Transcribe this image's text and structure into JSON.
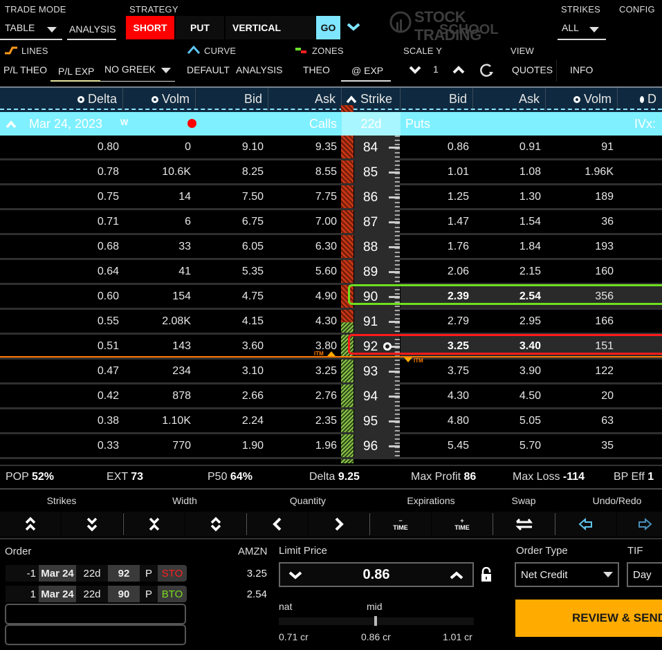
{
  "toolbar": {
    "trade_mode_label": "TRADE MODE",
    "trade_mode_value": "TABLE",
    "analysis_tab": "ANALYSIS",
    "strategy_label": "STRATEGY",
    "strategy_side": "SHORT",
    "strategy_type": "PUT",
    "strategy_kind": "VERTICAL",
    "go_button": "GO",
    "logo_line1": "STOCK TRADING",
    "logo_line2": "SCHOOL",
    "strikes_label": "STRIKES",
    "strikes_value": "ALL",
    "config_label": "CONFIG",
    "lines_label": "LINES",
    "curve_label": "CURVE",
    "zones_label": "ZONES",
    "scale_y_label": "SCALE Y",
    "view_label": "VIEW",
    "pl_theo": "P/L THEO",
    "pl_exp": "P/L EXP",
    "greek_value": "NO GREEK",
    "curve_default": "DEFAULT",
    "curve_analysis": "ANALYSIS",
    "zones_theo": "THEO",
    "zones_exp": "@ EXP",
    "scale_value": "1",
    "view_quotes": "QUOTES",
    "view_info": "INFO"
  },
  "grid": {
    "headers": {
      "call_delta": "Delta",
      "call_volm": "Volm",
      "call_bid": "Bid",
      "call_ask": "Ask",
      "strike": "Strike",
      "put_bid": "Bid",
      "put_ask": "Ask",
      "put_volm": "Volm",
      "put_delta": "D"
    },
    "expiration": {
      "date": "Mar 24, 2023",
      "weekly_tag": "W",
      "calls_label": "Calls",
      "dte": "22d",
      "puts_label": "Puts",
      "ivx_label": "IVx:"
    },
    "itm_label": "ITM",
    "rows": [
      {
        "delta": "0.80",
        "volm": "0",
        "bid": "9.10",
        "ask": "9.35",
        "strike": "84",
        "pbid": "0.86",
        "pask": "0.91",
        "pvolm": "91"
      },
      {
        "delta": "0.78",
        "volm": "10.6K",
        "bid": "8.25",
        "ask": "8.55",
        "strike": "85",
        "pbid": "1.01",
        "pask": "1.08",
        "pvolm": "1.96K"
      },
      {
        "delta": "0.75",
        "volm": "14",
        "bid": "7.50",
        "ask": "7.75",
        "strike": "86",
        "pbid": "1.25",
        "pask": "1.30",
        "pvolm": "189"
      },
      {
        "delta": "0.71",
        "volm": "6",
        "bid": "6.75",
        "ask": "7.00",
        "strike": "87",
        "pbid": "1.47",
        "pask": "1.54",
        "pvolm": "36"
      },
      {
        "delta": "0.68",
        "volm": "33",
        "bid": "6.05",
        "ask": "6.30",
        "strike": "88",
        "pbid": "1.76",
        "pask": "1.84",
        "pvolm": "193"
      },
      {
        "delta": "0.64",
        "volm": "41",
        "bid": "5.35",
        "ask": "5.60",
        "strike": "89",
        "pbid": "2.06",
        "pask": "2.15",
        "pvolm": "160"
      },
      {
        "delta": "0.60",
        "volm": "154",
        "bid": "4.75",
        "ask": "4.90",
        "strike": "90",
        "pbid": "2.39",
        "pask": "2.54",
        "pvolm": "356"
      },
      {
        "delta": "0.55",
        "volm": "2.08K",
        "bid": "4.15",
        "ask": "4.30",
        "strike": "91",
        "pbid": "2.79",
        "pask": "2.95",
        "pvolm": "166"
      },
      {
        "delta": "0.51",
        "volm": "143",
        "bid": "3.60",
        "ask": "3.80",
        "strike": "92",
        "pbid": "3.25",
        "pask": "3.40",
        "pvolm": "151"
      },
      {
        "delta": "0.47",
        "volm": "234",
        "bid": "3.10",
        "ask": "3.25",
        "strike": "93",
        "pbid": "3.75",
        "pask": "3.90",
        "pvolm": "122"
      },
      {
        "delta": "0.42",
        "volm": "878",
        "bid": "2.66",
        "ask": "2.76",
        "strike": "94",
        "pbid": "4.30",
        "pask": "4.50",
        "pvolm": "20"
      },
      {
        "delta": "0.38",
        "volm": "1.10K",
        "bid": "2.24",
        "ask": "2.35",
        "strike": "95",
        "pbid": "4.80",
        "pask": "5.05",
        "pvolm": "63"
      },
      {
        "delta": "0.33",
        "volm": "770",
        "bid": "1.90",
        "ask": "1.96",
        "strike": "96",
        "pbid": "5.45",
        "pask": "5.70",
        "pvolm": "35"
      }
    ]
  },
  "stats": {
    "pop_label": "POP",
    "pop_value": "52%",
    "ext_label": "EXT",
    "ext_value": "73",
    "p50_label": "P50",
    "p50_value": "64%",
    "delta_label": "Delta",
    "delta_value": "9.25",
    "maxprofit_label": "Max Profit",
    "maxprofit_value": "86",
    "maxloss_label": "Max Loss",
    "maxloss_value": "-114",
    "bp_label": "BP Eff",
    "bp_value": "1"
  },
  "controls": {
    "strikes": "Strikes",
    "width": "Width",
    "quantity": "Quantity",
    "expirations": "Expirations",
    "swap": "Swap",
    "undo_redo": "Undo/Redo",
    "time_label": "TIME",
    "minus": "−",
    "plus": "+"
  },
  "order": {
    "label": "Order",
    "symbol": "AMZN",
    "legs": [
      {
        "qty": "-1",
        "exp": "Mar 24",
        "dte": "22d",
        "strike": "92",
        "type": "P",
        "action": "STO",
        "price": "3.25",
        "action_color": "#ff2020"
      },
      {
        "qty": "1",
        "exp": "Mar 24",
        "dte": "22d",
        "strike": "90",
        "type": "P",
        "action": "BTO",
        "price": "2.54",
        "action_color": "#7ddc1f"
      }
    ],
    "limit_label": "Limit Price",
    "limit_value": "0.86",
    "nat_label": "nat",
    "mid_label": "mid",
    "nat_value": "0.71 cr",
    "mid_value": "0.86 cr",
    "far_value": "1.01 cr",
    "order_type_label": "Order Type",
    "order_type_value": "Net Credit",
    "tif_label": "TIF",
    "tif_value": "Day",
    "review_button": "REVIEW & SEND"
  },
  "colors": {
    "accent_cyan": "#7ff0ff",
    "short_red": "#ff0000",
    "review_orange": "#ffab00",
    "itm_orange": "#ff7a00",
    "buy_green": "#7ddc1f"
  }
}
